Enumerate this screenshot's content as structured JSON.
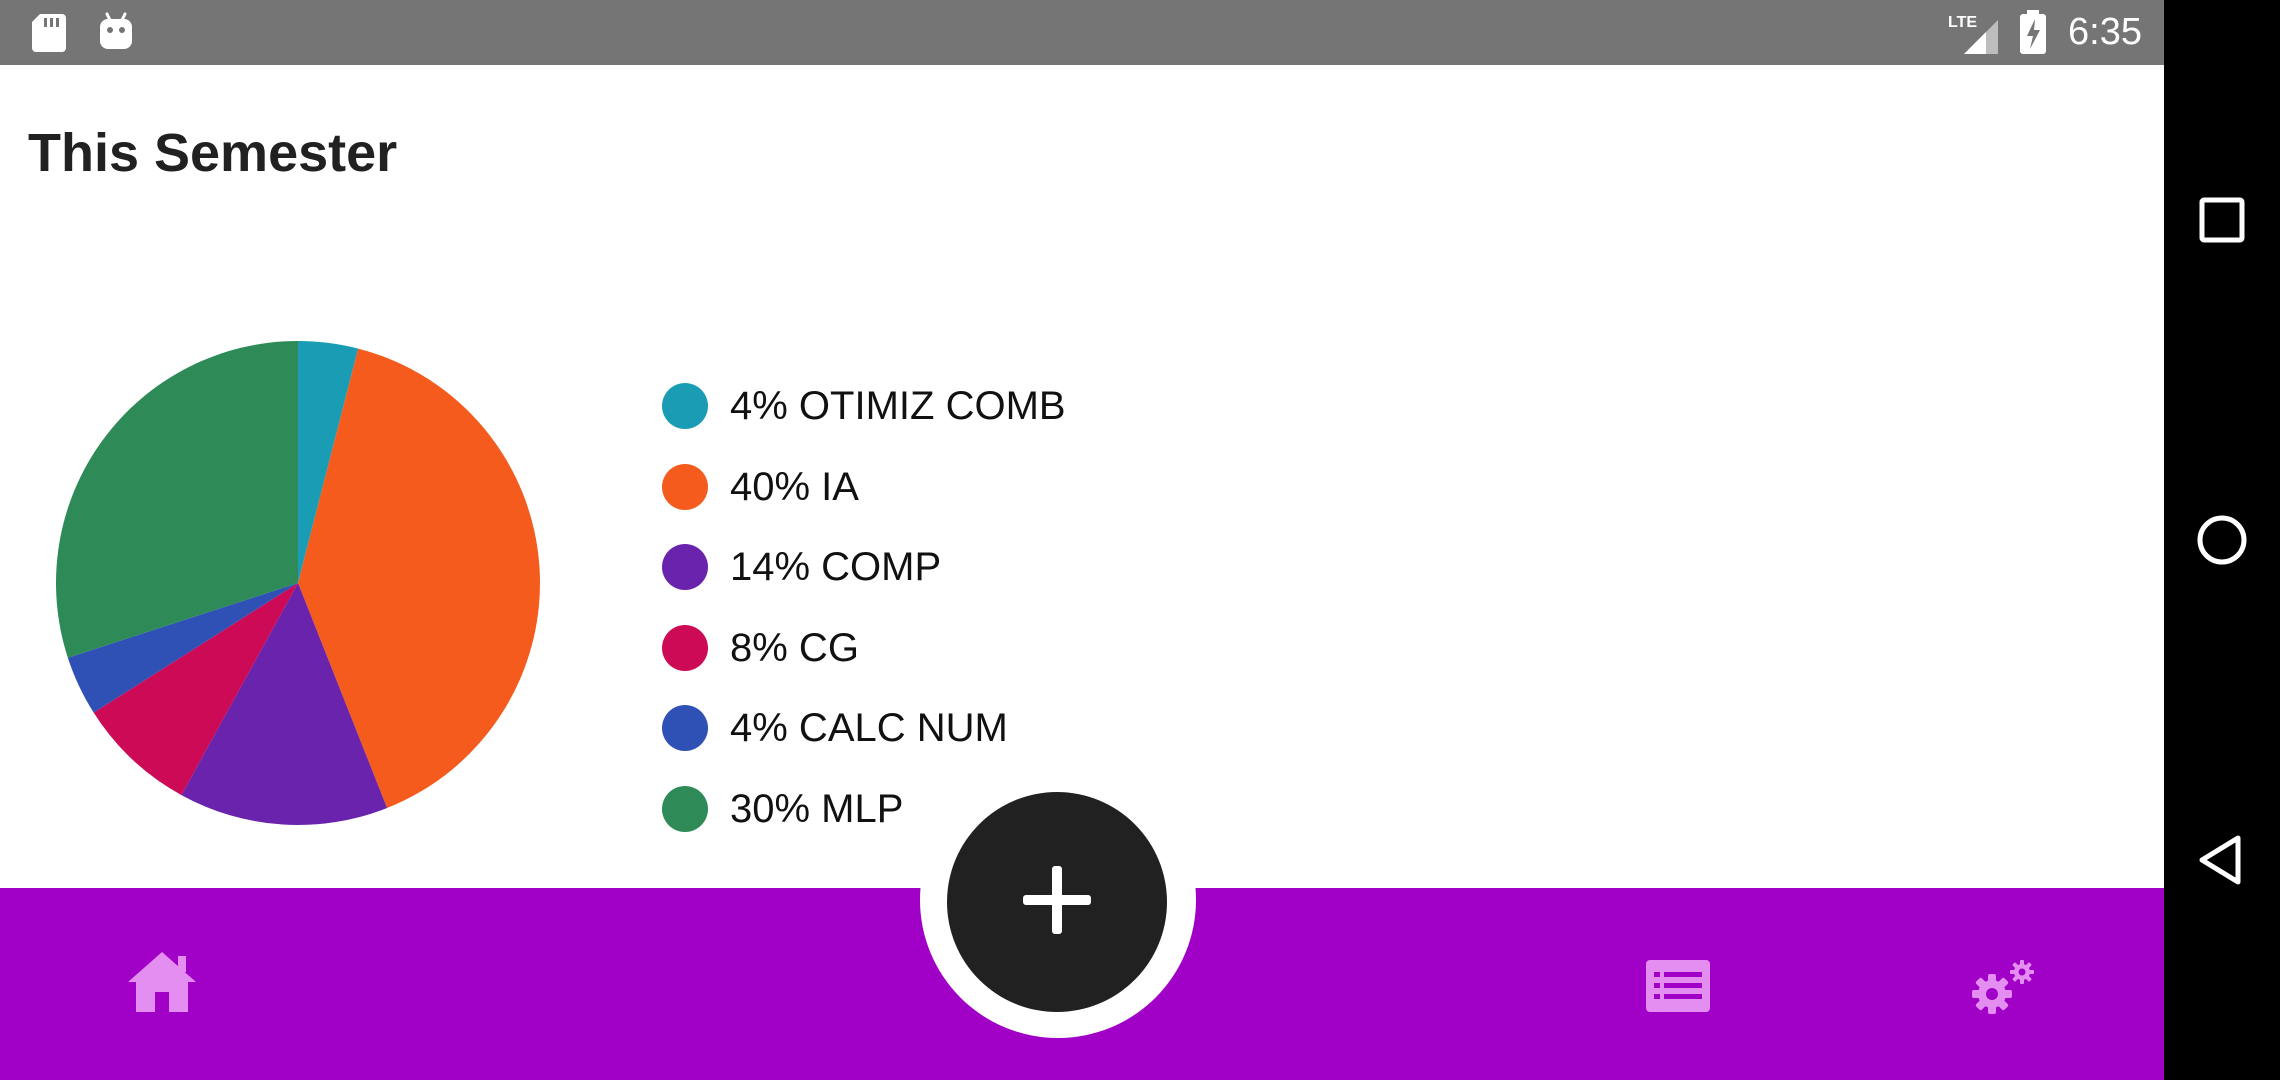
{
  "status_bar": {
    "time": "6:35",
    "network": "LTE",
    "icons": [
      "sd-card-icon",
      "android-icon",
      "lte-signal-icon",
      "battery-charging-icon"
    ]
  },
  "page": {
    "title": "This Semester"
  },
  "chart_data": {
    "type": "pie",
    "title": "",
    "slices": [
      {
        "label": "OTIMIZ COMB",
        "value": 4,
        "color": "#1a9db4"
      },
      {
        "label": "IA",
        "value": 40,
        "color": "#f45b1c"
      },
      {
        "label": "COMP",
        "value": 14,
        "color": "#6a23ad"
      },
      {
        "label": "CG",
        "value": 8,
        "color": "#cc0a56"
      },
      {
        "label": "CALC NUM",
        "value": 4,
        "color": "#2f51b6"
      },
      {
        "label": "MLP",
        "value": 30,
        "color": "#2e8b57"
      }
    ],
    "legend_entries": [
      "4% OTIMIZ COMB",
      "40% IA",
      "14% COMP",
      "8% CG",
      "4% CALC NUM",
      "30% MLP"
    ],
    "legend": "right"
  },
  "bottom_bar": {
    "color": "#a100c7",
    "icon_color": "#e58ef2",
    "items": [
      {
        "icon": "home-icon"
      },
      {
        "icon": "list-icon"
      },
      {
        "icon": "settings-icon"
      }
    ],
    "fab": {
      "icon": "plus-icon",
      "color": "#212121"
    }
  },
  "nav_bar": {
    "buttons": [
      "recents-square-icon",
      "home-circle-icon",
      "back-triangle-icon"
    ]
  }
}
